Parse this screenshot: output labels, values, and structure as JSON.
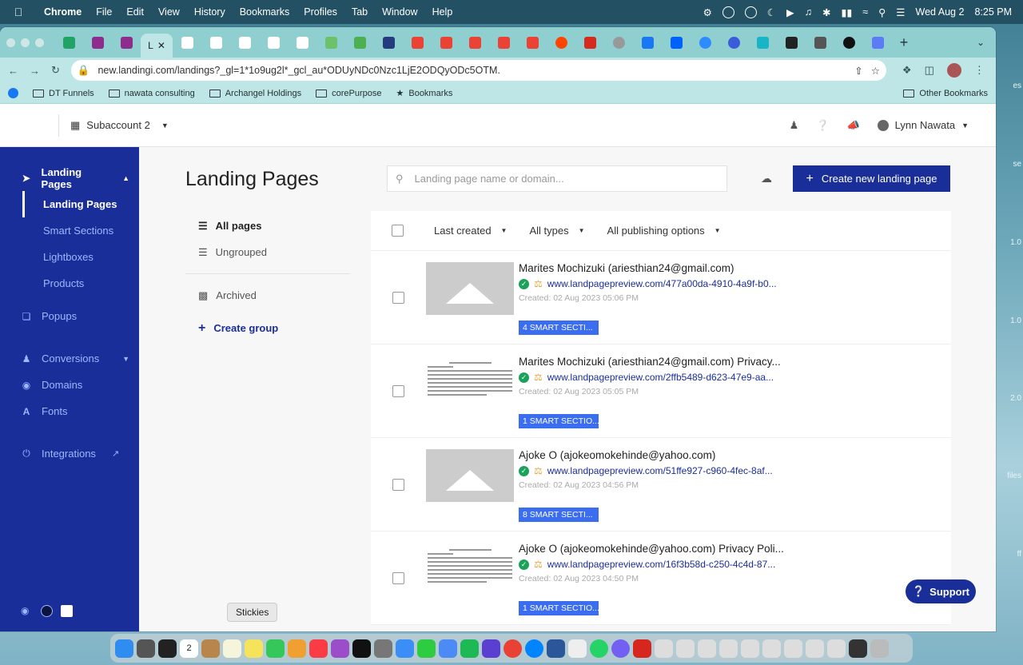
{
  "menubar": {
    "app": "Chrome",
    "items": [
      "File",
      "Edit",
      "View",
      "History",
      "Bookmarks",
      "Profiles",
      "Tab",
      "Window",
      "Help"
    ],
    "date": "Wed Aug 2",
    "time": "8:25 PM"
  },
  "browser": {
    "active_tab_label": "L",
    "url": "new.landingi.com/landings?_gl=1*1o9ug2l*_gcl_au*ODUyNDc0Nzc1LjE2ODQyODc5OTM.",
    "bookmarks": [
      "DT Funnels",
      "nawata consulting",
      "Archangel Holdings",
      "corePurpose",
      "Bookmarks"
    ],
    "other_bookmarks": "Other Bookmarks"
  },
  "header": {
    "subaccount": "Subaccount 2",
    "user": "Lynn Nawata"
  },
  "sidebar": {
    "section": "Landing Pages",
    "subitems": [
      "Landing Pages",
      "Smart Sections",
      "Lightboxes",
      "Products"
    ],
    "items": [
      "Popups",
      "Conversions",
      "Domains",
      "Fonts",
      "Integrations"
    ]
  },
  "main": {
    "title": "Landing Pages",
    "search_placeholder": "Landing page name or domain...",
    "create_button": "Create new landing page",
    "filters": {
      "all": "All pages",
      "ungrouped": "Ungrouped",
      "archived": "Archived",
      "create_group": "Create group"
    },
    "list_head": {
      "sort": "Last created",
      "types": "All types",
      "publishing": "All publishing options"
    },
    "rows": [
      {
        "title": "Marites Mochizuki (ariesthian24@gmail.com)",
        "url": "www.landpagepreview.com/477a00da-4910-4a9f-b0...",
        "created": "Created: 02 Aug 2023 05:06 PM",
        "badge": "4 SMART SECTI..."
      },
      {
        "title": "Marites Mochizuki (ariesthian24@gmail.com) Privacy...",
        "url": "www.landpagepreview.com/2ffb5489-d623-47e9-aa...",
        "created": "Created: 02 Aug 2023 05:05 PM",
        "badge": "1 SMART SECTIO..."
      },
      {
        "title": "Ajoke O (ajokeomokehinde@yahoo.com)",
        "url": "www.landpagepreview.com/51ffe927-c960-4fec-8af...",
        "created": "Created: 02 Aug 2023 04:56 PM",
        "badge": "8 SMART SECTI..."
      },
      {
        "title": "Ajoke O (ajokeomokehinde@yahoo.com) Privacy Poli...",
        "url": "www.landpagepreview.com/16f3b58d-c250-4c4d-87...",
        "created": "Created: 02 Aug 2023 04:50 PM",
        "badge": "1 SMART SECTIO..."
      }
    ],
    "support": "Support"
  },
  "dock": {
    "tooltip": "Stickies",
    "calendar_day": "2"
  },
  "desktop_labels": [
    "es",
    "se",
    "1.0",
    "1.0",
    "2.0",
    "files",
    "ff"
  ],
  "colors": {
    "brand": "#1a2e9a",
    "badge": "#3a6df0",
    "published": "#1aa15a"
  }
}
